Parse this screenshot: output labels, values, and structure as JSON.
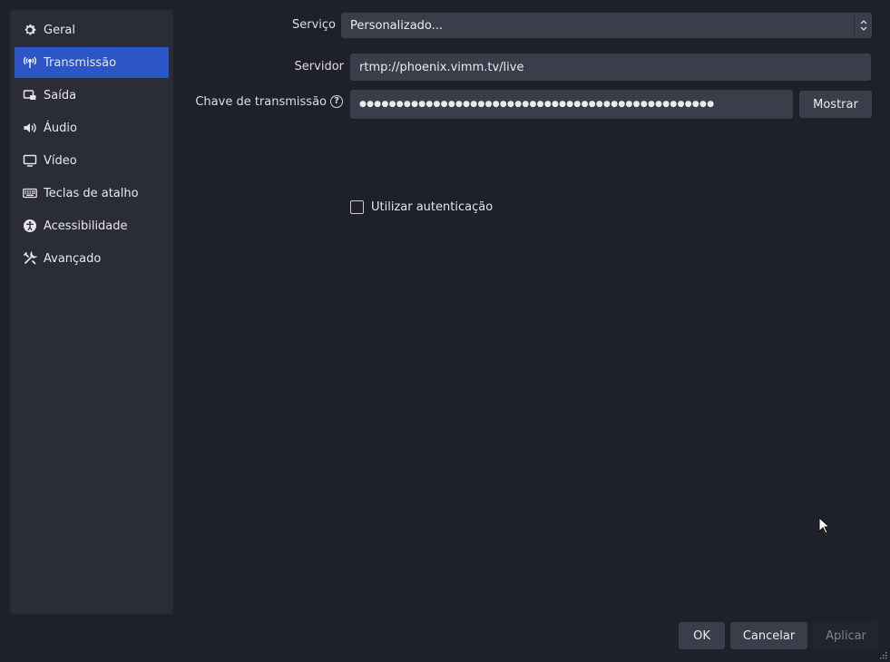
{
  "sidebar": {
    "items": [
      {
        "label": "Geral",
        "icon": "gear-icon"
      },
      {
        "label": "Transmissão",
        "icon": "broadcast-icon",
        "active": true
      },
      {
        "label": "Saída",
        "icon": "output-icon"
      },
      {
        "label": "Áudio",
        "icon": "speaker-icon"
      },
      {
        "label": "Vídeo",
        "icon": "monitor-icon"
      },
      {
        "label": "Teclas de atalho",
        "icon": "keyboard-icon"
      },
      {
        "label": "Acessibilidade",
        "icon": "accessibility-icon"
      },
      {
        "label": "Avançado",
        "icon": "tools-icon"
      }
    ]
  },
  "form": {
    "service_label": "Serviço",
    "service_value": "Personalizado...",
    "server_label": "Servidor",
    "server_value": "rtmp://phoenix.vimm.tv/live",
    "key_label": "Chave de transmissão",
    "key_help": "?",
    "key_value": "●●●●●●●●●●●●●●●●●●●●●●●●●●●●●●●●●●●●●●●●●●●●●●●●",
    "show_button": "Mostrar",
    "auth_label": "Utilizar autenticação",
    "auth_checked": false
  },
  "footer": {
    "ok": "OK",
    "cancel": "Cancelar",
    "apply": "Aplicar"
  },
  "colors": {
    "background": "#1f212a",
    "sidebar": "#2a2d38",
    "active": "#2c55c8",
    "input": "#3a3d4a"
  }
}
